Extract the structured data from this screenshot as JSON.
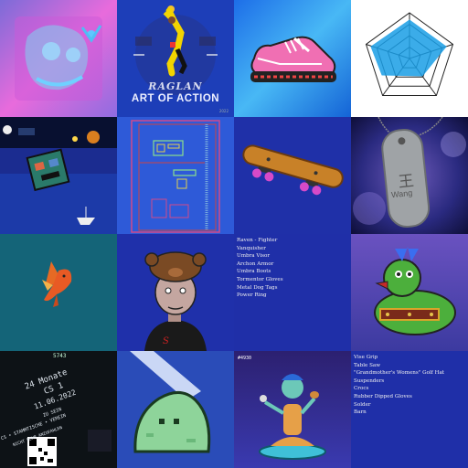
{
  "tiles": {
    "art_of_action": {
      "line1": "RAGLAN",
      "line2": "ART OF ACTION",
      "fine": "2022"
    },
    "dog_tag": {
      "chinese": "王",
      "name": "Wang"
    },
    "loot_bag_1": {
      "items": [
        "Raven - Fighter",
        "Vanquisher",
        "Umbra Visor",
        "Archon Armor",
        "Umbra Boots",
        "Tormentor Gloves",
        "Metal Dog Tags",
        "Power Ring"
      ]
    },
    "flyer": {
      "lines": [
        "24 Monate",
        "CS 1",
        "11.06.2022",
        "CS • STAMMTISCHE • VEREIN",
        "ZU SEIN",
        "NICHT MEHR ANZUFAHLEN"
      ],
      "number": "5743"
    },
    "pixel_id": {
      "number": "#4930"
    },
    "loot_bag_2": {
      "items": [
        "Vise Grip",
        "Table Saw",
        "\"Grandmother's Womens\" Golf Hat",
        "Suspenders",
        "Crocs",
        "Rubber Dipped Gloves",
        "Solder",
        "Barn"
      ]
    }
  },
  "colors": {
    "radar_fill": "#1a9ee6",
    "deep_blue": "#1f2fa8",
    "teal": "#146478",
    "duck_green": "#4caf3c"
  }
}
